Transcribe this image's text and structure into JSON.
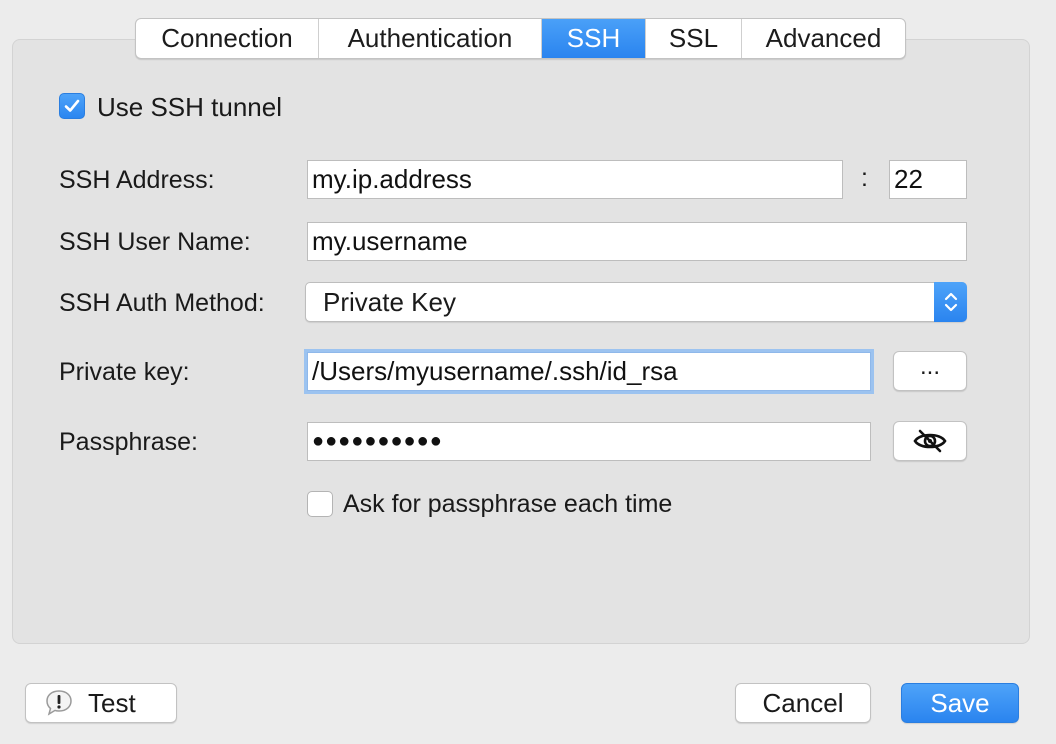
{
  "tabs": [
    {
      "label": "Connection",
      "active": false
    },
    {
      "label": "Authentication",
      "active": false
    },
    {
      "label": "SSH",
      "active": true
    },
    {
      "label": "SSL",
      "active": false
    },
    {
      "label": "Advanced",
      "active": false
    }
  ],
  "use_ssh_tunnel": {
    "label": "Use SSH tunnel",
    "checked": true
  },
  "ssh_address": {
    "label": "SSH Address:",
    "value": "my.ip.address",
    "port_separator": ":",
    "port": "22"
  },
  "ssh_user_name": {
    "label": "SSH User Name:",
    "value": "my.username"
  },
  "ssh_auth_method": {
    "label": "SSH Auth Method:",
    "selected": "Private Key"
  },
  "private_key": {
    "label": "Private key:",
    "value": "/Users/myusername/.ssh/id_rsa",
    "browse_label": "..."
  },
  "passphrase": {
    "label": "Passphrase:",
    "value": "●●●●●●●●●●",
    "reveal_icon": "eye-slash-icon"
  },
  "ask_passphrase": {
    "label": "Ask for passphrase each time",
    "checked": false
  },
  "footer": {
    "test_label": "Test",
    "test_icon": "exclamation-bubble-icon",
    "cancel_label": "Cancel",
    "save_label": "Save"
  },
  "colors": {
    "accent": "#2a84ef",
    "panel": "#e3e3e3",
    "window": "#ececec"
  }
}
